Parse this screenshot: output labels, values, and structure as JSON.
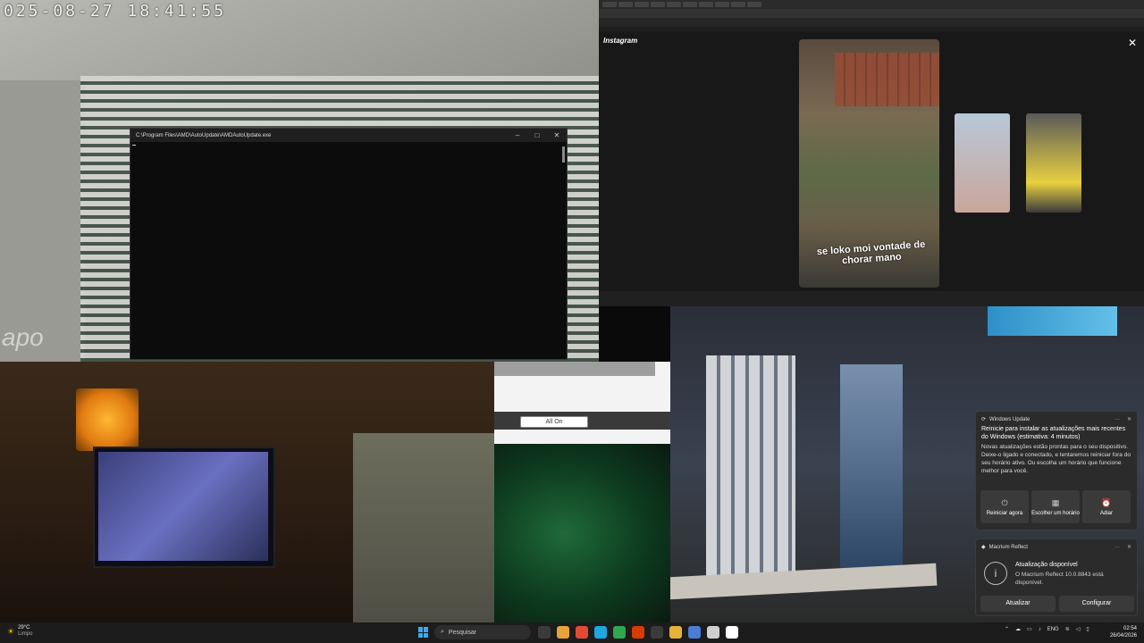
{
  "camera1": {
    "timestamp": "025-08-27  18:41:55",
    "watermark": "apo"
  },
  "console": {
    "title": "C:\\Program Files\\AMD\\AutoUpdate\\AMDAutoUpdate.exe",
    "minimize": "–",
    "maximize": "□",
    "close": "✕"
  },
  "browser": {
    "instagram_logo": "Instagram",
    "close": "✕",
    "story_caption": "se loko moi vontade de chorar mano"
  },
  "panel": {
    "button_label": "All On"
  },
  "windows_update": {
    "app_name": "Windows Update",
    "more": "···",
    "close": "✕",
    "title": "Reinicie para instalar as atualizações mais recentes do Windows (estimativa: 4 minutos)",
    "body": "Novas atualizações estão prontas para o seu dispositivo. Deixe-o ligado e conectado, e tentaremos reiniciar fora do seu horário ativo. Ou escolha um horário que funcione melhor para você.",
    "actions": [
      {
        "icon": "⏻",
        "label": "Reiniciar agora"
      },
      {
        "icon": "▦",
        "label": "Escolher um horário"
      },
      {
        "icon": "⏰",
        "label": "Adiar"
      }
    ]
  },
  "macrium": {
    "app_name": "Macrium Reflect",
    "more": "···",
    "close": "✕",
    "info_icon": "i",
    "title": "Atualização disponível",
    "body": "O Macrium Reflect 10.0.8843 está disponível.",
    "actions": [
      "Atualizar",
      "Configurar"
    ]
  },
  "taskbar": {
    "temperature": "29°C",
    "condition": "Limpo",
    "search_placeholder": "Pesquisar",
    "language": "ENG",
    "time": "02:54",
    "date": "26/04/2026",
    "app_colors": [
      "#3b3b3b",
      "#e8a33a",
      "#e24a33",
      "#1ca8e0",
      "#2fa84f",
      "#d83b01",
      "#3a3a3a",
      "#e6b23a",
      "#4c7dd4",
      "#cfcfcf",
      "#ffffff"
    ]
  }
}
